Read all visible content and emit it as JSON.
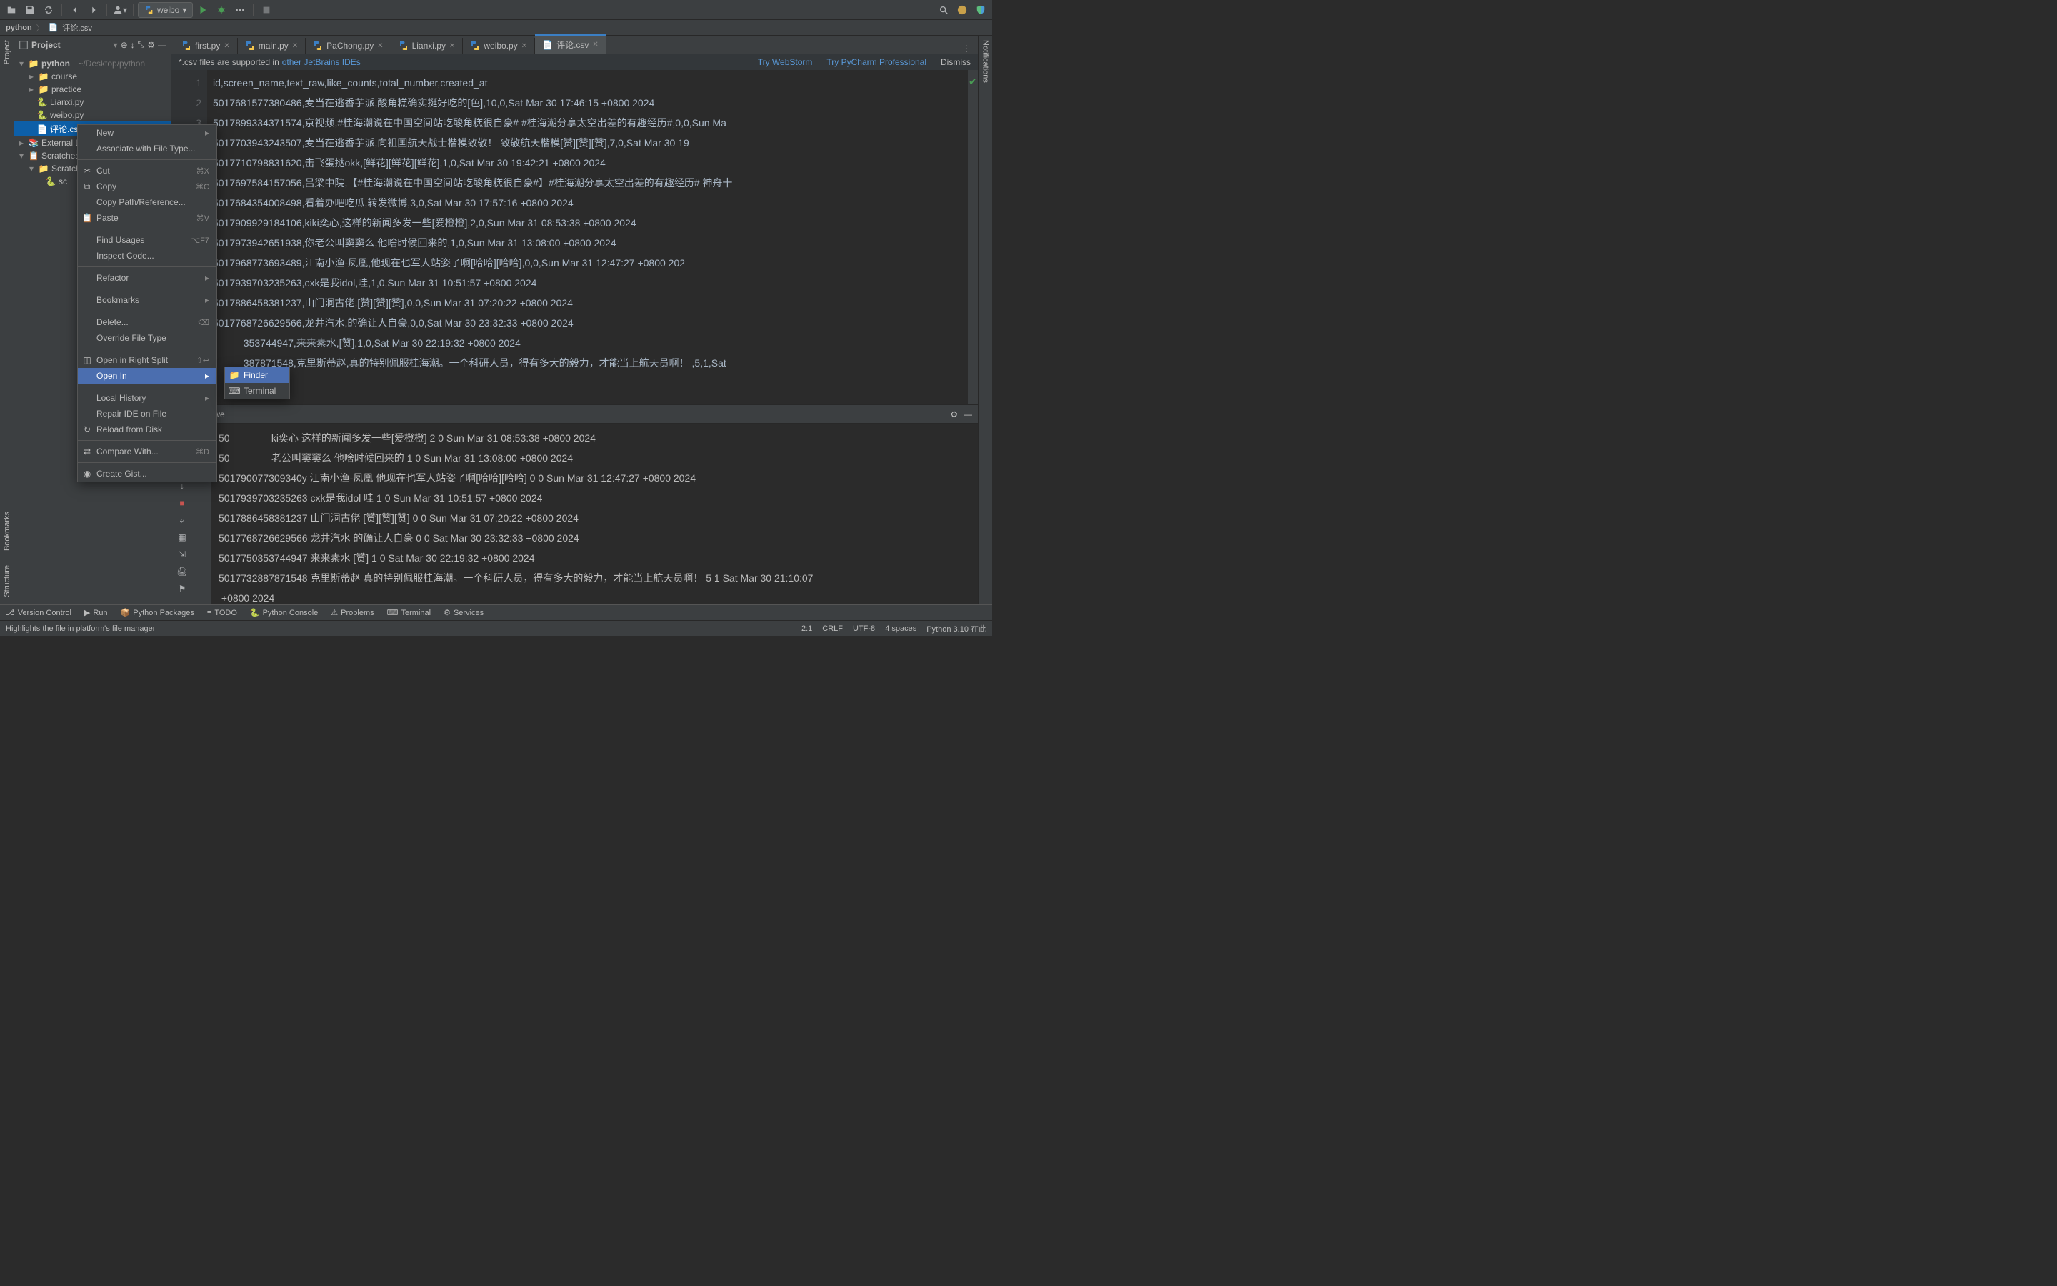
{
  "toolbar": {
    "runconfig": "weibo"
  },
  "navbar": {
    "root": "python",
    "file": "评论.csv"
  },
  "project": {
    "title": "Project",
    "root": "python",
    "root_path": "~/Desktop/python",
    "items": [
      "course",
      "practice",
      "Lianxi.py",
      "weibo.py",
      "评论.csv"
    ],
    "external": "External Libraries",
    "scratches": "Scratches and Consoles",
    "scratches_child": "Scratches",
    "scratches_file": "sc"
  },
  "tabs": [
    {
      "label": "first.py"
    },
    {
      "label": "main.py"
    },
    {
      "label": "PaChong.py"
    },
    {
      "label": "Lianxi.py"
    },
    {
      "label": "weibo.py"
    },
    {
      "label": "评论.csv",
      "active": true
    }
  ],
  "banner": {
    "text": "*.csv files are supported in",
    "link": "other JetBrains IDEs",
    "try1": "Try WebStorm",
    "try2": "Try PyCharm Professional",
    "dismiss": "Dismiss"
  },
  "editor_lines": [
    "id,screen_name,text_raw,like_counts,total_number,created_at",
    "5017681577380486,麦当在逃香芋派,酸角糕确实挺好吃的[色],10,0,Sat Mar 30 17:46:15 +0800 2024",
    "5017899334371574,京视频,#桂海潮说在中国空间站吃酸角糕很自豪# #桂海潮分享太空出差的有趣经历#,0,0,Sun Ma",
    "5017703943243507,麦当在逃香芋派,向祖国航天战士楷模致敬！ 致敬航天楷模[赞][赞][赞],7,0,Sat Mar 30 19",
    "5017710798831620,击飞蛋挞okk,[鲜花][鲜花][鲜花],1,0,Sat Mar 30 19:42:21 +0800 2024",
    "5017697584157056,吕梁中院,【#桂海潮说在中国空间站吃酸角糕很自豪#】#桂海潮分享太空出差的有趣经历# 神舟十",
    "5017684354008498,看着办吧吃瓜,转发微博,3,0,Sat Mar 30 17:57:16 +0800 2024",
    "5017909929184106,kiki奕心,这样的新闻多发一些[爱橙橙],2,0,Sun Mar 31 08:53:38 +0800 2024",
    "5017973942651938,你老公叫窦窦么,他啥时候回来的,1,0,Sun Mar 31 13:08:00 +0800 2024",
    "5017968773693489,江南小渔-凤凰,他现在也军人站姿了啊[哈哈][哈哈],0,0,Sun Mar 31 12:47:27 +0800 202",
    "5017939703235263,cxk是我idol,哇,1,0,Sun Mar 31 10:51:57 +0800 2024",
    "5017886458381237,山门洞古佬,[赞][赞][赞],0,0,Sun Mar 31 07:20:22 +0800 2024",
    "5017768726629566,龙井汽水,的确让人自豪,0,0,Sat Mar 30 23:32:33 +0800 2024",
    "           353744947,来来素水,[赞],1,0,Sat Mar 30 22:19:32 +0800 2024",
    "           387871548,克里斯蒂赵,真的特别佩服桂海潮。一个科研人员，得有多大的毅力，才能当上航天员啊！ ,5,1,Sat"
  ],
  "run": {
    "label": "Run:",
    "config": "we",
    "output": [
      "50               ki奕心 这样的新闻多发一些[爱橙橙] 2 0 Sun Mar 31 08:53:38 +0800 2024",
      "50               老公叫窦窦么 他啥时候回来的 1 0 Sun Mar 31 13:08:00 +0800 2024",
      "501790077309340y 江南小渔-凤凰 他现在也军人站姿了啊[哈哈][哈哈] 0 0 Sun Mar 31 12:47:27 +0800 2024",
      "5017939703235263 cxk是我idol 哇 1 0 Sun Mar 31 10:51:57 +0800 2024",
      "5017886458381237 山门洞古佬 [赞][赞][赞] 0 0 Sun Mar 31 07:20:22 +0800 2024",
      "5017768726629566 龙井汽水 的确让人自豪 0 0 Sat Mar 30 23:32:33 +0800 2024",
      "5017750353744947 来来素水 [赞] 1 0 Sat Mar 30 22:19:32 +0800 2024",
      "5017732887871548 克里斯蒂赵 真的特别佩服桂海潮。一个科研人员，得有多大的毅力，才能当上航天员啊！ 5 1 Sat Mar 30 21:10:07",
      " +0800 2024"
    ]
  },
  "context_menu": {
    "items": [
      {
        "label": "New",
        "arrow": true
      },
      {
        "label": "Associate with File Type..."
      },
      {
        "sep": true
      },
      {
        "label": "Cut",
        "shortcut": "⌘X",
        "icon": "cut"
      },
      {
        "label": "Copy",
        "shortcut": "⌘C",
        "icon": "copy"
      },
      {
        "label": "Copy Path/Reference..."
      },
      {
        "label": "Paste",
        "shortcut": "⌘V",
        "icon": "paste"
      },
      {
        "sep": true
      },
      {
        "label": "Find Usages",
        "shortcut": "⌥F7"
      },
      {
        "label": "Inspect Code..."
      },
      {
        "sep": true
      },
      {
        "label": "Refactor",
        "arrow": true
      },
      {
        "sep": true
      },
      {
        "label": "Bookmarks",
        "arrow": true
      },
      {
        "sep": true
      },
      {
        "label": "Delete...",
        "shortcut": "⌫"
      },
      {
        "label": "Override File Type"
      },
      {
        "sep": true
      },
      {
        "label": "Open in Right Split",
        "shortcut": "⇧↩",
        "icon": "split"
      },
      {
        "label": "Open In",
        "arrow": true,
        "hover": true
      },
      {
        "sep": true
      },
      {
        "label": "Local History",
        "arrow": true
      },
      {
        "label": "Repair IDE on File"
      },
      {
        "label": "Reload from Disk",
        "icon": "reload"
      },
      {
        "sep": true
      },
      {
        "label": "Compare With...",
        "shortcut": "⌘D",
        "icon": "compare"
      },
      {
        "sep": true
      },
      {
        "label": "Create Gist...",
        "icon": "github"
      }
    ],
    "submenu": [
      {
        "label": "Finder",
        "hover": true,
        "icon": "finder"
      },
      {
        "label": "Terminal",
        "icon": "terminal"
      }
    ]
  },
  "bottom_tools": [
    "Version Control",
    "Run",
    "Python Packages",
    "TODO",
    "Python Console",
    "Problems",
    "Terminal",
    "Services"
  ],
  "statusbar": {
    "hint": "Highlights the file in platform's file manager",
    "pos": "2:1",
    "eol": "CRLF",
    "enc": "UTF-8",
    "indent": "4 spaces",
    "interp": "Python 3.10 在此"
  },
  "gutters": {
    "project": "Project",
    "bookmarks": "Bookmarks",
    "structure": "Structure",
    "notifications": "Notifications"
  }
}
